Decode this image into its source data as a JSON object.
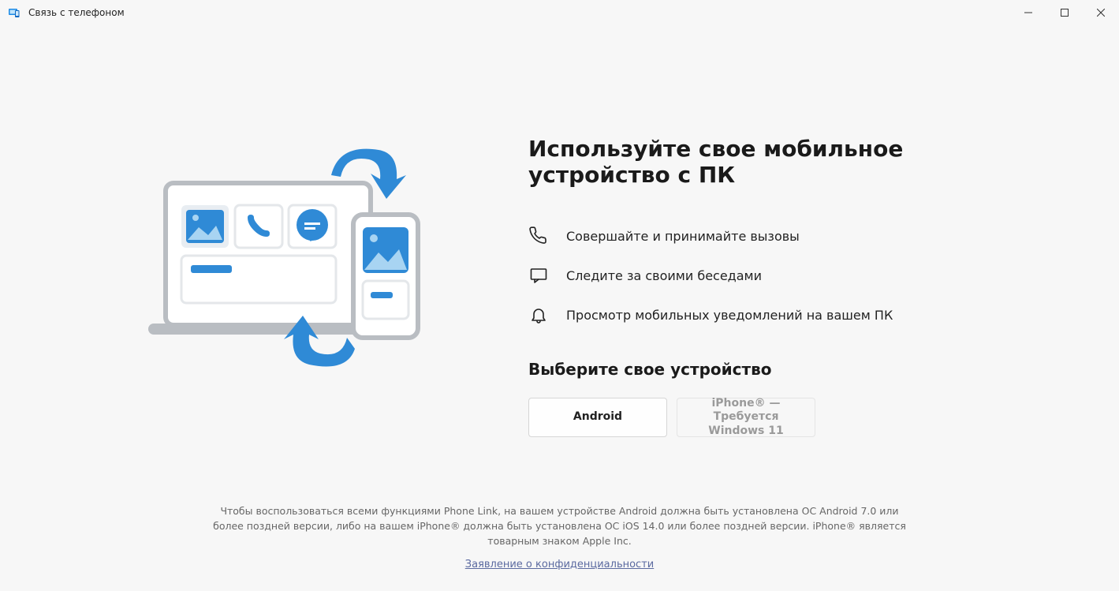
{
  "window": {
    "title": "Связь с телефоном"
  },
  "main": {
    "headline": "Используйте свое мобильное устройство с ПК",
    "features": [
      {
        "icon": "phone-icon",
        "text": "Совершайте и принимайте вызовы"
      },
      {
        "icon": "chat-icon",
        "text": "Следите за своими беседами"
      },
      {
        "icon": "bell-icon",
        "text": "Просмотр мобильных уведомлений на вашем ПК"
      }
    ],
    "subhead": "Выберите свое устройство",
    "buttons": {
      "android": "Android",
      "iphone": "iPhone® — Требуется Windows 11"
    }
  },
  "footer": {
    "disclaimer": "Чтобы воспользоваться всеми функциями Phone Link, на вашем устройстве Android должна быть установлена ОС Android 7.0 или более поздней версии, либо на вашем iPhone® должна быть установлена ОС iOS 14.0 или более поздней версии. iPhone® является товарным знаком Apple Inc.",
    "privacy": "Заявление о конфиденциальности"
  }
}
